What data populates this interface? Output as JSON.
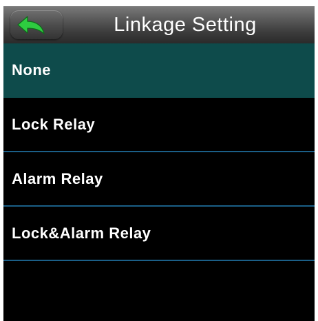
{
  "header": {
    "title": "Linkage Setting",
    "back_icon": "back-arrow-icon",
    "back_icon_color": "#2ecc40"
  },
  "menu": {
    "selected_index": 0,
    "selected_color": "#0e4b4b",
    "divider_color": "#1b5f88",
    "items": [
      {
        "label": "None"
      },
      {
        "label": "Lock Relay"
      },
      {
        "label": "Alarm Relay"
      },
      {
        "label": "Lock&Alarm Relay"
      }
    ]
  }
}
